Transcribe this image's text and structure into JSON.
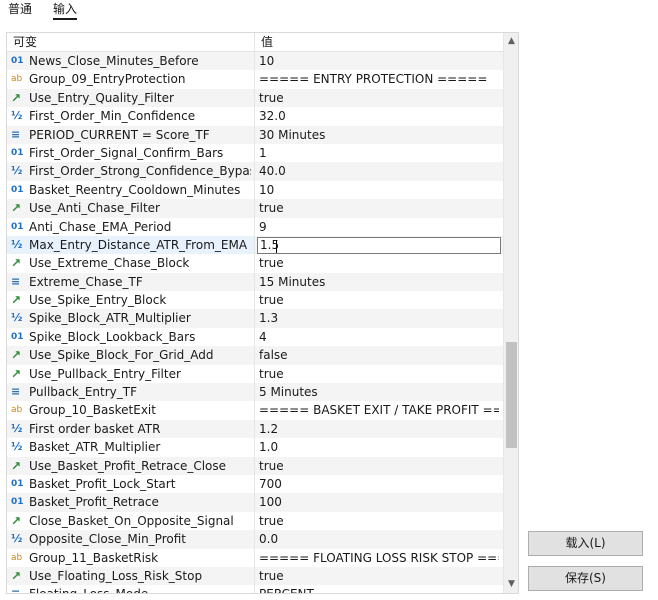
{
  "tabs": [
    {
      "label": "普通",
      "active": false
    },
    {
      "label": "输入",
      "active": true
    }
  ],
  "grid": {
    "header_name": "可变",
    "header_value": "值"
  },
  "rows": [
    {
      "icon": "int",
      "icon_glyph": "01",
      "name": "News_Close_Minutes_Before",
      "value": "10"
    },
    {
      "icon": "string",
      "icon_glyph": "ab",
      "name": "Group_09_EntryProtection",
      "value": "===== ENTRY PROTECTION ====="
    },
    {
      "icon": "bool",
      "icon_glyph": "↗",
      "name": "Use_Entry_Quality_Filter",
      "value": "true"
    },
    {
      "icon": "double",
      "icon_glyph": "½",
      "name": "First_Order_Min_Confidence",
      "value": "32.0"
    },
    {
      "icon": "enum",
      "icon_glyph": "≡",
      "name": "PERIOD_CURRENT = Score_TF",
      "value": "30 Minutes"
    },
    {
      "icon": "int",
      "icon_glyph": "01",
      "name": "First_Order_Signal_Confirm_Bars",
      "value": "1"
    },
    {
      "icon": "double",
      "icon_glyph": "½",
      "name": "First_Order_Strong_Confidence_Bypass...",
      "value": "40.0"
    },
    {
      "icon": "int",
      "icon_glyph": "01",
      "name": "Basket_Reentry_Cooldown_Minutes",
      "value": "10"
    },
    {
      "icon": "bool",
      "icon_glyph": "↗",
      "name": "Use_Anti_Chase_Filter",
      "value": "true"
    },
    {
      "icon": "int",
      "icon_glyph": "01",
      "name": "Anti_Chase_EMA_Period",
      "value": "9"
    },
    {
      "icon": "double",
      "icon_glyph": "½",
      "name": "Max_Entry_Distance_ATR_From_EMA",
      "value": "1.5",
      "selected": true
    },
    {
      "icon": "bool",
      "icon_glyph": "↗",
      "name": "Use_Extreme_Chase_Block",
      "value": "true"
    },
    {
      "icon": "enum",
      "icon_glyph": "≡",
      "name": "Extreme_Chase_TF",
      "value": "15 Minutes"
    },
    {
      "icon": "bool",
      "icon_glyph": "↗",
      "name": "Use_Spike_Entry_Block",
      "value": "true"
    },
    {
      "icon": "double",
      "icon_glyph": "½",
      "name": "Spike_Block_ATR_Multiplier",
      "value": "1.3"
    },
    {
      "icon": "int",
      "icon_glyph": "01",
      "name": "Spike_Block_Lookback_Bars",
      "value": "4"
    },
    {
      "icon": "bool",
      "icon_glyph": "↗",
      "name": "Use_Spike_Block_For_Grid_Add",
      "value": "false"
    },
    {
      "icon": "bool",
      "icon_glyph": "↗",
      "name": "Use_Pullback_Entry_Filter",
      "value": "true"
    },
    {
      "icon": "enum",
      "icon_glyph": "≡",
      "name": "Pullback_Entry_TF",
      "value": "5 Minutes"
    },
    {
      "icon": "string",
      "icon_glyph": "ab",
      "name": "Group_10_BasketExit",
      "value": "===== BASKET EXIT / TAKE PROFIT ===..."
    },
    {
      "icon": "double",
      "icon_glyph": "½",
      "name": "First order basket ATR",
      "value": "1.2"
    },
    {
      "icon": "double",
      "icon_glyph": "½",
      "name": "Basket_ATR_Multiplier",
      "value": "1.0"
    },
    {
      "icon": "bool",
      "icon_glyph": "↗",
      "name": "Use_Basket_Profit_Retrace_Close",
      "value": "true"
    },
    {
      "icon": "int",
      "icon_glyph": "01",
      "name": "Basket_Profit_Lock_Start",
      "value": "700"
    },
    {
      "icon": "int",
      "icon_glyph": "01",
      "name": "Basket_Profit_Retrace",
      "value": "100"
    },
    {
      "icon": "bool",
      "icon_glyph": "↗",
      "name": "Close_Basket_On_Opposite_Signal",
      "value": "true"
    },
    {
      "icon": "double",
      "icon_glyph": "½",
      "name": "Opposite_Close_Min_Profit",
      "value": "0.0"
    },
    {
      "icon": "string",
      "icon_glyph": "ab",
      "name": "Group_11_BasketRisk",
      "value": "===== FLOATING LOSS RISK STOP ===..."
    },
    {
      "icon": "bool",
      "icon_glyph": "↗",
      "name": "Use_Floating_Loss_Risk_Stop",
      "value": "true"
    },
    {
      "icon": "enum",
      "icon_glyph": "≡",
      "name": "Floating_Loss_Mode",
      "value": "PERCENT"
    }
  ],
  "scroll": {
    "up_glyph": "▲",
    "down_glyph": "▼"
  },
  "buttons": {
    "load_label": "载入(L)",
    "save_label": "保存(S)"
  }
}
